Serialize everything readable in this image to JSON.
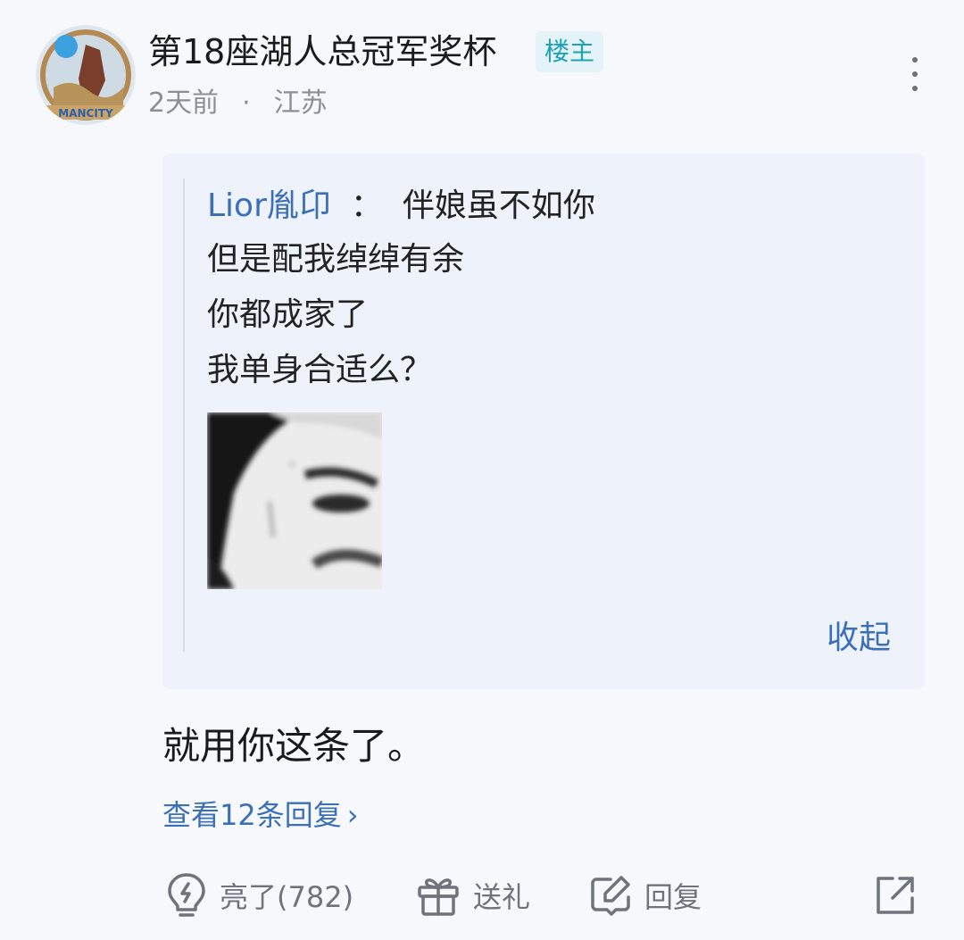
{
  "post": {
    "avatar_icon": "circular-badge-avatar",
    "username": "第18座湖人总冠军奖杯",
    "op_badge": "楼主",
    "time": "2天前",
    "separator": "·",
    "location": "江苏",
    "more_icon": "vertical-ellipsis-icon"
  },
  "quote": {
    "author": "Lior胤卬",
    "colon": "：",
    "lines": [
      "伴娘虽不如你",
      "但是配我绰绰有余",
      "你都成家了",
      "我单身合适么？"
    ],
    "image_icon": "face-meme-image",
    "collapse_label": "收起"
  },
  "comment": {
    "text": "就用你这条了。",
    "view_replies": "查看12条回复",
    "chevron": "›"
  },
  "actions": {
    "like_icon": "lightbulb-icon",
    "like_label": "亮了(782)",
    "gift_icon": "gift-icon",
    "gift_label": "送礼",
    "reply_icon": "edit-icon",
    "reply_label": "回复",
    "share_icon": "share-icon"
  },
  "colors": {
    "background": "#f6f8fc",
    "card": "#eef2fa",
    "link": "#3b6fb8",
    "badge_text": "#1ea0b8",
    "muted": "#8a8f98"
  }
}
